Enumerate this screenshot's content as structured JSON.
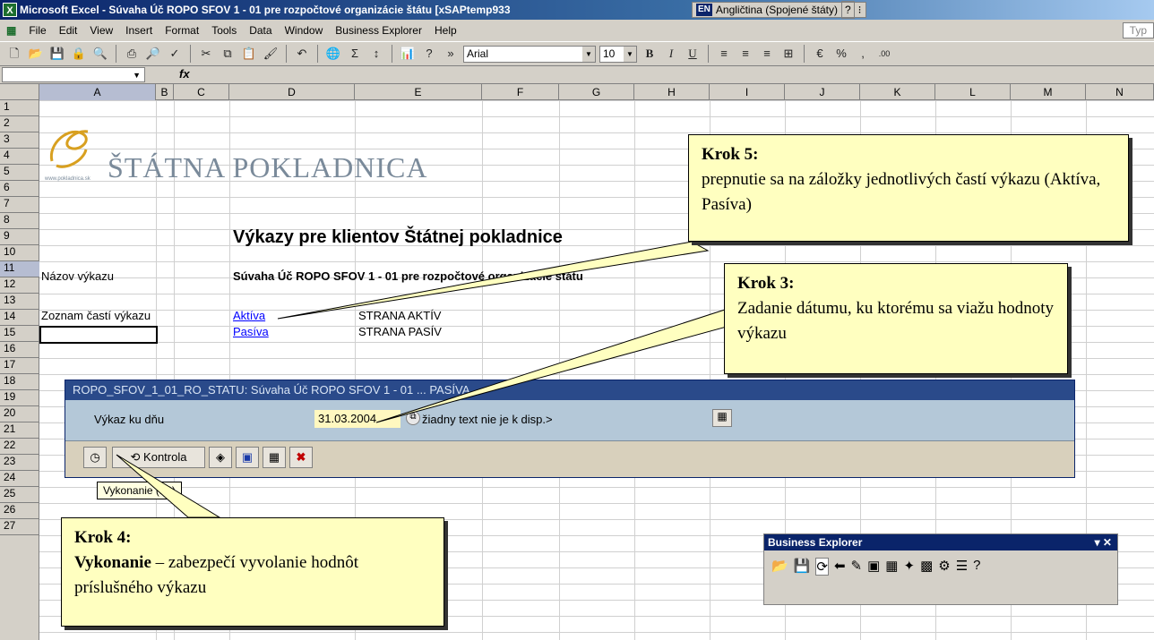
{
  "window": {
    "title": "Microsoft Excel - Súvaha Úč ROPO SFOV 1 - 01 pre rozpočtové organizácie štátu [xSAPtemp933",
    "lang_code": "EN",
    "lang_label": "Angličtina (Spojené štáty)",
    "type_question": "Typ"
  },
  "menu": [
    "File",
    "Edit",
    "View",
    "Insert",
    "Format",
    "Tools",
    "Data",
    "Window",
    "Business Explorer",
    "Help"
  ],
  "toolbar": {
    "font": "Arial",
    "size": "10"
  },
  "formula": {
    "fx": "fx"
  },
  "columns": [
    "A",
    "B",
    "C",
    "D",
    "E",
    "F",
    "G",
    "H",
    "I",
    "J",
    "K",
    "L",
    "M",
    "N"
  ],
  "rows": [
    "1",
    "2",
    "3",
    "4",
    "5",
    "6",
    "7",
    "8",
    "9",
    "10",
    "11",
    "12",
    "13",
    "14",
    "15",
    "16",
    "17",
    "18",
    "19",
    "20",
    "21",
    "22",
    "23",
    "24",
    "25",
    "26",
    "27"
  ],
  "logo": {
    "text": "ŠTÁTNA POKLADNICA",
    "url": "www.pokladnica.sk"
  },
  "sheet": {
    "heading": "Výkazy pre klientov Štátnej pokladnice",
    "name_label": "Názov výkazu",
    "name_value": "Súvaha Úč ROPO SFOV 1 - 01 pre rozpočtové organizácie štátu",
    "parts_label": "Zoznam častí výkazu",
    "parts": [
      {
        "link": "Aktíva",
        "desc": "STRANA AKTÍV"
      },
      {
        "link": "Pasíva",
        "desc": "STRANA PASÍV"
      }
    ]
  },
  "dialog": {
    "title": "ROPO_SFOV_1_01_RO_STATU: Súvaha Úč ROPO SFOV 1 - 01 ... PASÍVA",
    "field_label": "Výkaz ku dňu",
    "field_value": "31.03.2004",
    "field_hint": "žiadny text nie je k disp.>",
    "check_label": "Kontrola",
    "tooltip": "Vykonanie  (F8)"
  },
  "callouts": {
    "step5_title": "Krok 5:",
    "step5_text": "prepnutie sa na záložky jednotlivých častí výkazu (Aktíva, Pasíva)",
    "step3_title": "Krok 3:",
    "step3_text": "Zadanie dátumu, ku ktorému sa viažu hodnoty výkazu",
    "step4_title": "Krok 4:",
    "step4_bold": "Vykonanie",
    "step4_text": " – zabezpečí vyvolanie hodnôt príslušného výkazu"
  },
  "business_explorer": {
    "title": "Business Explorer"
  }
}
